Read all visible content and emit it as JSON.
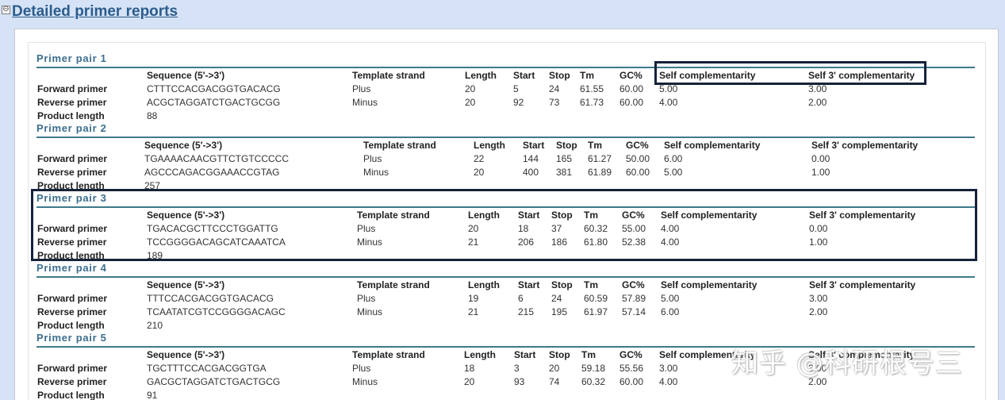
{
  "header": {
    "title": "Detailed primer reports",
    "toggle": "⊖"
  },
  "columns": [
    "Sequence (5'->3')",
    "Template strand",
    "Length",
    "Start",
    "Stop",
    "Tm",
    "GC%",
    "Self complementarity",
    "Self 3' complementarity"
  ],
  "labels": {
    "forward": "Forward primer",
    "reverse": "Reverse primer",
    "product": "Product length"
  },
  "pairs": [
    {
      "title": "Primer pair 1",
      "forward": [
        "CTTTCCACGACGGTGACACG",
        "Plus",
        "20",
        "5",
        "24",
        "61.55",
        "60.00",
        "5.00",
        "3.00"
      ],
      "reverse": [
        "ACGCTAGGATCTGACTGCGG",
        "Minus",
        "20",
        "92",
        "73",
        "61.73",
        "60.00",
        "4.00",
        "2.00"
      ],
      "product_length": "88"
    },
    {
      "title": "Primer pair 2",
      "forward": [
        "TGAAAACAACGTTCTGTCCCCC",
        "Plus",
        "22",
        "144",
        "165",
        "61.27",
        "50.00",
        "6.00",
        "0.00"
      ],
      "reverse": [
        "AGCCCAGACGGAAACCGTAG",
        "Minus",
        "20",
        "400",
        "381",
        "61.89",
        "60.00",
        "5.00",
        "1.00"
      ],
      "product_length": "257"
    },
    {
      "title": "Primer pair 3",
      "forward": [
        "TGACACGCTTCCCTGGATTG",
        "Plus",
        "20",
        "18",
        "37",
        "60.32",
        "55.00",
        "4.00",
        "0.00"
      ],
      "reverse": [
        "TCCGGGGACAGCATCAAATCA",
        "Minus",
        "21",
        "206",
        "186",
        "61.80",
        "52.38",
        "4.00",
        "1.00"
      ],
      "product_length": "189"
    },
    {
      "title": "Primer pair 4",
      "forward": [
        "TTTCCACGACGGTGACACG",
        "Plus",
        "19",
        "6",
        "24",
        "60.59",
        "57.89",
        "5.00",
        "3.00"
      ],
      "reverse": [
        "TCAATATCGTCCGGGGACAGC",
        "Minus",
        "21",
        "215",
        "195",
        "61.97",
        "57.14",
        "6.00",
        "2.00"
      ],
      "product_length": "210"
    },
    {
      "title": "Primer pair 5",
      "forward": [
        "TGCTTTCCACGACGGTGA",
        "Plus",
        "18",
        "3",
        "20",
        "59.18",
        "55.56",
        "3.00",
        "3.00"
      ],
      "reverse": [
        "GACGCTAGGATCTGACTGCG",
        "Minus",
        "20",
        "93",
        "74",
        "60.32",
        "60.00",
        "4.00",
        "2.00"
      ],
      "product_length": "91"
    }
  ],
  "watermark": "知乎 @科研根号三",
  "colors": {
    "background": "#d6e3f6",
    "title": "#2b5c8d",
    "pair_title": "#3b6e8e",
    "rule": "#3e7a8a",
    "highlight_box": "#15233a"
  }
}
